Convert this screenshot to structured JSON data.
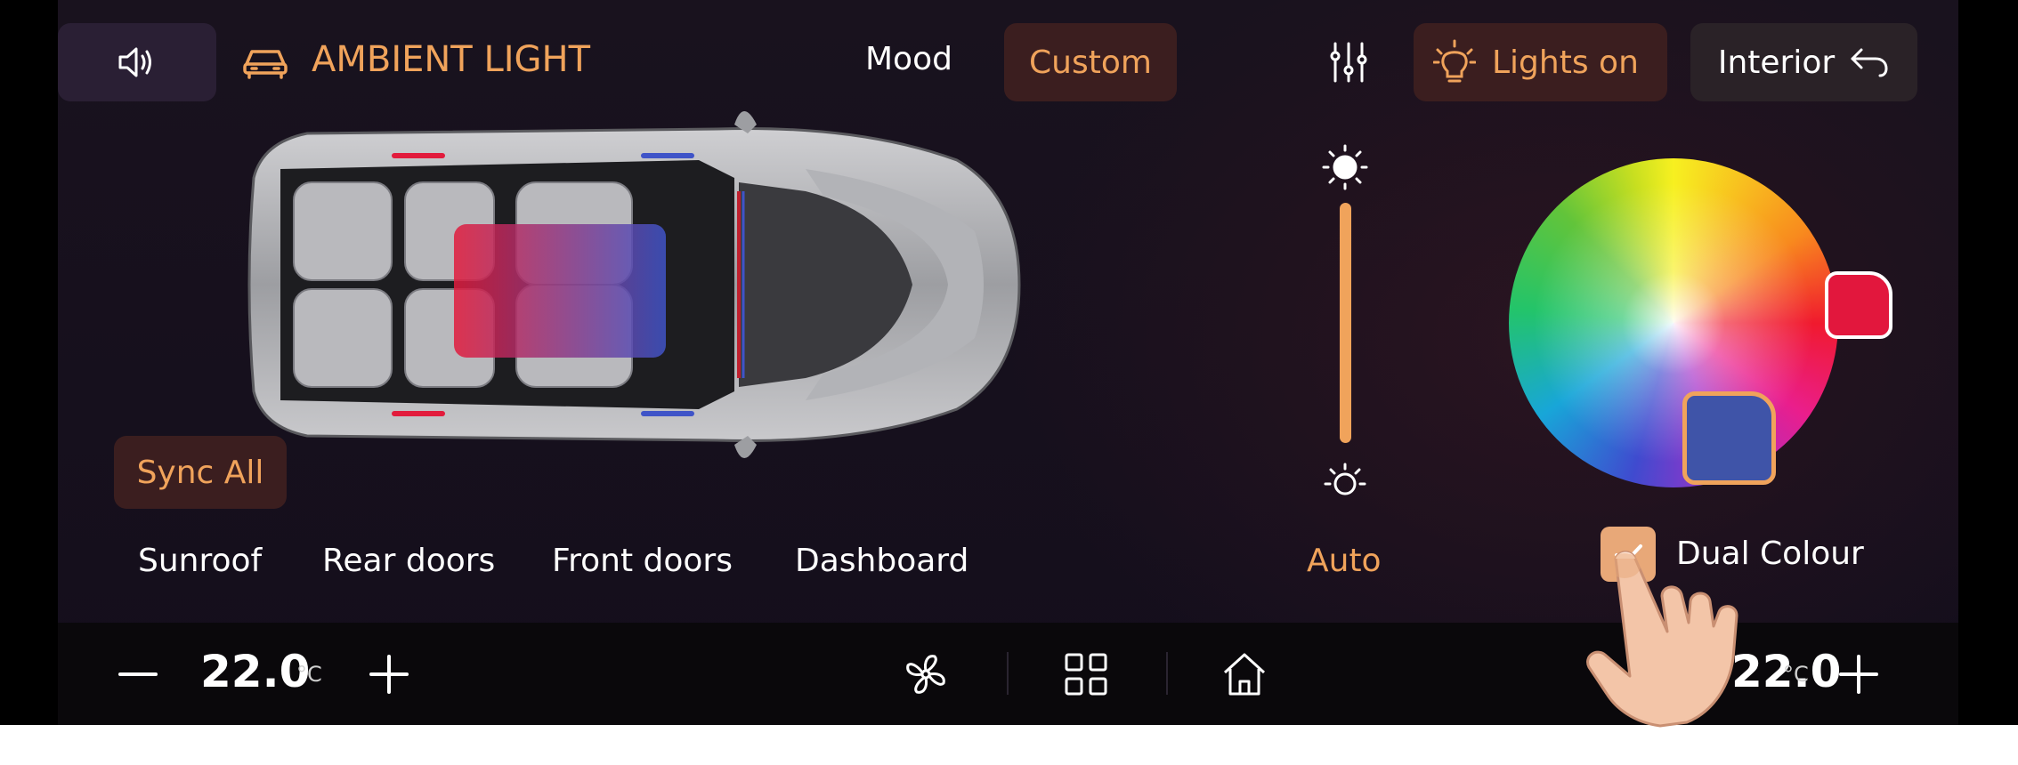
{
  "header": {
    "title": "AMBIENT LIGHT",
    "tabs": [
      {
        "label": "Mood"
      },
      {
        "label": "Custom"
      }
    ],
    "lights_label": "Lights on",
    "interior_label": "Interior"
  },
  "zones": {
    "sync_label": "Sync All",
    "items": [
      {
        "label": "Sunroof"
      },
      {
        "label": "Rear doors"
      },
      {
        "label": "Front doors"
      },
      {
        "label": "Dashboard"
      }
    ]
  },
  "brightness": {
    "auto_label": "Auto",
    "level": 1.0
  },
  "colour": {
    "dual_label": "Dual Colour",
    "dual_checked": true,
    "primary": "#e2173d",
    "secondary": "#3f54a8"
  },
  "climate": {
    "left_temp": "22.0",
    "left_unit": "°C",
    "right_temp": "22.0",
    "right_unit": "°C"
  },
  "colors": {
    "accent": "#f0a35b",
    "background": "#17111d"
  }
}
